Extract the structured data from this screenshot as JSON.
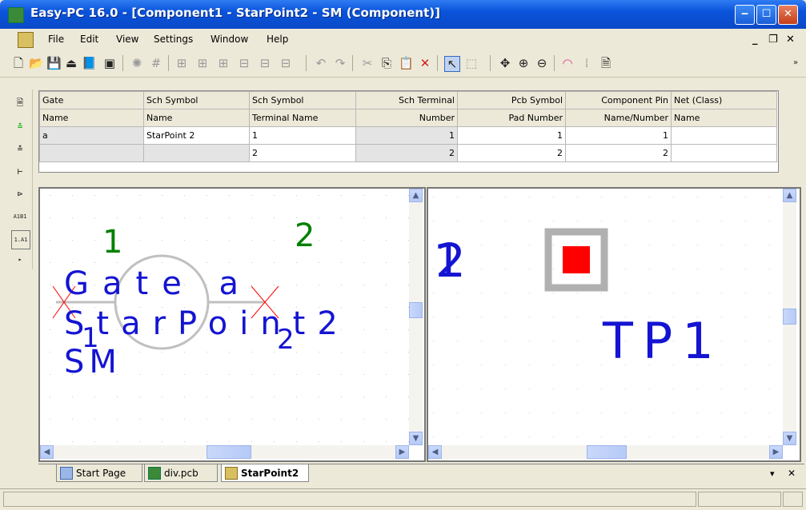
{
  "window": {
    "title": "Easy-PC 16.0 - [Component1 - StarPoint2 - SM (Component)]"
  },
  "menu": {
    "items": [
      "File",
      "Edit",
      "View",
      "Settings",
      "Window",
      "Help"
    ]
  },
  "grid": {
    "header1": [
      "Gate",
      "Sch Symbol",
      "Sch Symbol",
      "Sch Terminal",
      "Pcb Symbol",
      "Component Pin",
      "Net (Class)"
    ],
    "header2": [
      "Name",
      "Name",
      "Terminal Name",
      "Number",
      "Pad Number",
      "Name/Number",
      "Name"
    ],
    "rows": [
      [
        "a",
        "StarPoint 2",
        "1",
        "1",
        "1",
        "1",
        ""
      ],
      [
        "",
        "",
        "2",
        "2",
        "2",
        "2",
        ""
      ]
    ]
  },
  "schematic": {
    "pin_numbers": [
      "1",
      "2"
    ],
    "gate_label": "Gate a",
    "symbol_name": "StarPoint2",
    "package": "SM",
    "terminal_labels": [
      "1",
      "2"
    ]
  },
  "pcb": {
    "pad_labels": [
      "1",
      "2"
    ],
    "component_ref": "TP1"
  },
  "tabs": [
    {
      "label": "Start Page",
      "icon": "start-page-icon"
    },
    {
      "label": "div.pcb",
      "icon": "pcb-doc-icon"
    },
    {
      "label": "StarPoint2",
      "icon": "component-doc-icon"
    }
  ],
  "colors": {
    "titlebar": "#0A54DB",
    "schematic_text": "#1414D2",
    "pin_number": "#008000",
    "pad_fill": "#FF0000",
    "pad_ring": "#B0B0B0",
    "pin_cross": "#FF0000"
  }
}
